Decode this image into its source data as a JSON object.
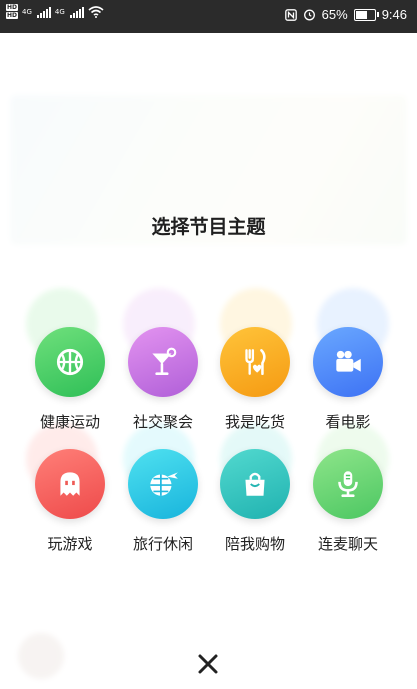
{
  "status_bar": {
    "sim1": "HD",
    "sim2": "HD",
    "net1": "4G",
    "net2": "4G",
    "battery_text": "65%",
    "battery_level": 0.65,
    "time": "9:46",
    "icons": [
      "nfc-icon",
      "alarm-icon",
      "battery-icon",
      "wifi-icon"
    ]
  },
  "modal": {
    "title": "选择节目主题",
    "close_icon": "close-icon"
  },
  "themes": [
    {
      "label": "健康运动",
      "icon": "basketball-icon",
      "color_top": "#6fe07c",
      "color_bottom": "#2fbf57"
    },
    {
      "label": "社交聚会",
      "icon": "cocktail-icon",
      "color_top": "#e393f0",
      "color_bottom": "#b05fd8"
    },
    {
      "label": "我是吃货",
      "icon": "utensils-icon",
      "color_top": "#ffc43a",
      "color_bottom": "#f59a12"
    },
    {
      "label": "看电影",
      "icon": "video-camera-icon",
      "color_top": "#6aa8ff",
      "color_bottom": "#3d72f4"
    },
    {
      "label": "玩游戏",
      "icon": "ghost-icon",
      "color_top": "#ff7f78",
      "color_bottom": "#ee4a4a"
    },
    {
      "label": "旅行休闲",
      "icon": "globe-plane-icon",
      "color_top": "#4fe1f0",
      "color_bottom": "#18b4dc"
    },
    {
      "label": "陪我购物",
      "icon": "shopping-bag-icon",
      "color_top": "#52d9cf",
      "color_bottom": "#20b2b0"
    },
    {
      "label": "连麦聊天",
      "icon": "microphone-icon",
      "color_top": "#8ee58a",
      "color_bottom": "#4cc762"
    }
  ]
}
